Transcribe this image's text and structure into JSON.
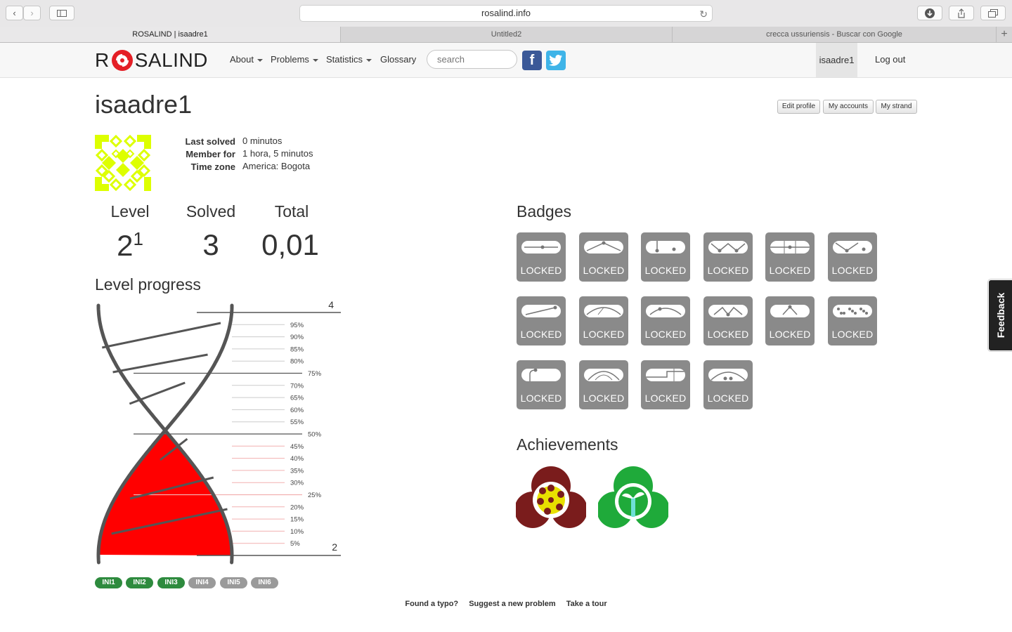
{
  "browser": {
    "url": "rosalind.info",
    "tabs": [
      {
        "title": "ROSALIND | isaadre1",
        "active": true
      },
      {
        "title": "Untitled2",
        "active": false
      },
      {
        "title": "crecca ussuriensis - Buscar con Google",
        "active": false
      }
    ]
  },
  "nav": {
    "logo_left": "R",
    "logo_right": "SALIND",
    "items": [
      "About",
      "Problems",
      "Statistics",
      "Glossary"
    ],
    "search_placeholder": "search",
    "facebook_icon_glyph": "f",
    "user": "isaadre1",
    "logout": "Log out"
  },
  "profile": {
    "username": "isaadre1",
    "buttons": [
      "Edit profile",
      "My accounts",
      "My strand"
    ],
    "info": [
      {
        "label": "Last solved",
        "value": "0 minutos"
      },
      {
        "label": "Member for",
        "value": "1 hora, 5 minutos"
      },
      {
        "label": "Time zone",
        "value": "America: Bogota"
      }
    ],
    "stats": {
      "level_label": "Level",
      "level": "2",
      "level_sup": "1",
      "solved_label": "Solved",
      "solved": "3",
      "total_label": "Total",
      "total": "0,01"
    }
  },
  "level_progress": {
    "title": "Level progress",
    "top_level": "4",
    "bottom_level": "2",
    "progress_percent": 50,
    "percent_labels": [
      "95%",
      "90%",
      "85%",
      "80%",
      "75%",
      "70%",
      "65%",
      "60%",
      "55%",
      "50%",
      "45%",
      "40%",
      "35%",
      "30%",
      "25%",
      "20%",
      "15%",
      "10%",
      "5%"
    ]
  },
  "problem_tags": [
    {
      "label": "INI1",
      "solved": true
    },
    {
      "label": "INI2",
      "solved": true
    },
    {
      "label": "INI3",
      "solved": true
    },
    {
      "label": "INI4",
      "solved": false
    },
    {
      "label": "INI5",
      "solved": false
    },
    {
      "label": "INI6",
      "solved": false
    }
  ],
  "badges": {
    "title": "Badges",
    "items": [
      "LOCKED",
      "LOCKED",
      "LOCKED",
      "LOCKED",
      "LOCKED",
      "LOCKED",
      "LOCKED",
      "LOCKED",
      "LOCKED",
      "LOCKED",
      "LOCKED",
      "LOCKED",
      "LOCKED",
      "LOCKED",
      "LOCKED",
      "LOCKED"
    ]
  },
  "achievements": {
    "title": "Achievements",
    "items": [
      "flower-achievement-icon",
      "sprout-achievement-icon"
    ]
  },
  "footer": {
    "links": [
      "Found a typo?",
      "Suggest a new problem",
      "Take a tour"
    ]
  },
  "feedback": "Feedback",
  "colors": {
    "progress_fill": "#ff0000",
    "solved_tag": "#2e8b3e",
    "unsolved_tag": "#9a9a9a",
    "badge_bg": "#8a8a8a",
    "avatar": "#ddff00"
  }
}
